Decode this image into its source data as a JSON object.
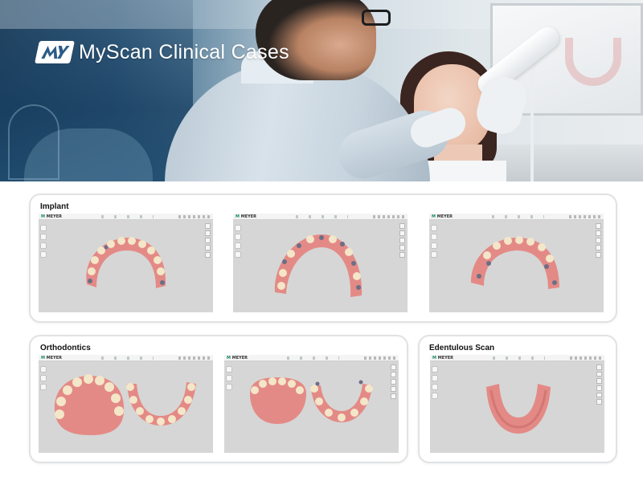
{
  "banner": {
    "brand_title": "MyScan Clinical Cases",
    "logo_icon": "myscan-logo-icon"
  },
  "sections": {
    "implant": {
      "title": "Implant"
    },
    "orthodontics": {
      "title": "Orthodontics"
    },
    "edentulous": {
      "title": "Edentulous Scan"
    }
  },
  "screenshot_ui": {
    "app_logo": "MEYER"
  },
  "colors": {
    "gum": "#e48a86",
    "tooth": "#f4e6c8",
    "viewport": "#d6d6d6",
    "implant": "#6b6f86"
  }
}
